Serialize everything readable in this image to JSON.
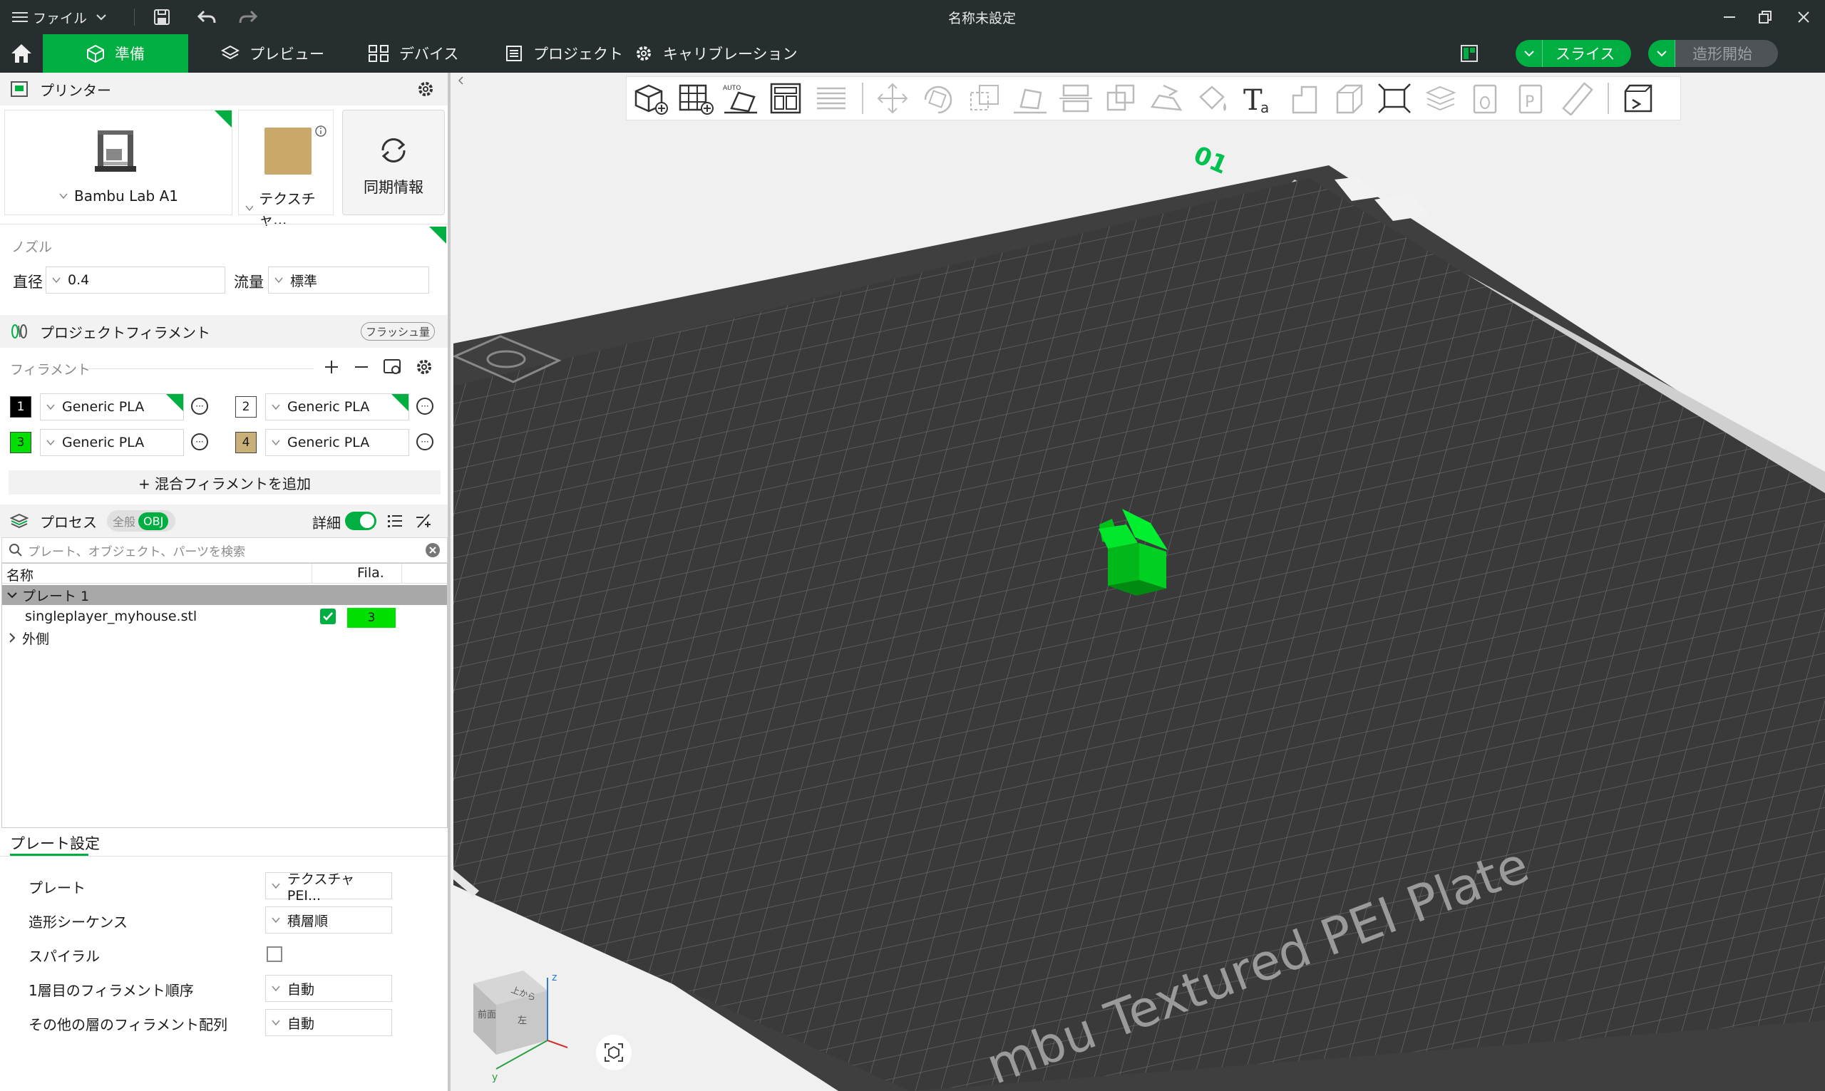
{
  "window": {
    "menu_label": "ファイル",
    "title": "名称未設定"
  },
  "tabs": [
    {
      "label": "準備",
      "icon": "cube-icon",
      "active": true
    },
    {
      "label": "プレビュー",
      "icon": "layers-icon",
      "active": false
    },
    {
      "label": "デバイス",
      "icon": "device-icon",
      "active": false
    },
    {
      "label": "プロジェクト",
      "icon": "document-icon",
      "active": false
    },
    {
      "label": "キャリブレーション",
      "icon": "gear-icon",
      "active": false
    }
  ],
  "actions": {
    "slice_label": "スライス",
    "print_label": "造形開始",
    "accent": "#00ae42"
  },
  "printer": {
    "section_title": "プリンター",
    "printer_name": "Bambu Lab A1",
    "plate_name": "テクスチャ...",
    "sync_label": "同期情報"
  },
  "nozzle": {
    "section_label": "ノズル",
    "diameter_label": "直径",
    "diameter_value": "0.4",
    "flow_label": "流量",
    "flow_value": "標準"
  },
  "filament": {
    "section_title": "プロジェクトフィラメント",
    "flush_button": "フラッシュ量",
    "list_label": "フィラメント",
    "slots": [
      {
        "num": "1",
        "name": "Generic PLA",
        "color": "#000000",
        "text_color": "#ffffff"
      },
      {
        "num": "2",
        "name": "Generic PLA",
        "color": "#ffffff",
        "text_color": "#1a1a1a"
      },
      {
        "num": "3",
        "name": "Generic PLA",
        "color": "#00e000",
        "text_color": "#1a1a1a"
      },
      {
        "num": "4",
        "name": "Generic PLA",
        "color": "#c8b078",
        "text_color": "#1a1a1a"
      }
    ],
    "add_mix_label": "+ 混合フィラメントを追加"
  },
  "process": {
    "section_title": "プロセス",
    "toggle_global": "全般",
    "toggle_obj": "OBJ",
    "detail_label": "詳細",
    "search_placeholder": "プレート、オブジェクト、パーツを検索",
    "col_name": "名称",
    "col_fila": "Fila.",
    "plate_row": "プレート 1",
    "object_name": "singleplayer_myhouse.stl",
    "object_fila": "3",
    "outer_row": "外側"
  },
  "plate_settings": {
    "tab_label": "プレート設定",
    "rows": [
      {
        "label": "プレート",
        "value": "テクスチャ PEI..."
      },
      {
        "label": "造形シーケンス",
        "value": "積層順"
      },
      {
        "label": "スパイラル",
        "value": ""
      },
      {
        "label": "1層目のフィラメント順序",
        "value": "自動"
      },
      {
        "label": "その他の層のフィラメント配列",
        "value": "自動"
      }
    ]
  },
  "viewport": {
    "plate_number": "01",
    "plate_label": "mbu Textured PEI Plate",
    "cube_labels": {
      "top": "上から",
      "front": "前面",
      "left": "左"
    },
    "axes": {
      "z": "z",
      "y": "y"
    }
  }
}
